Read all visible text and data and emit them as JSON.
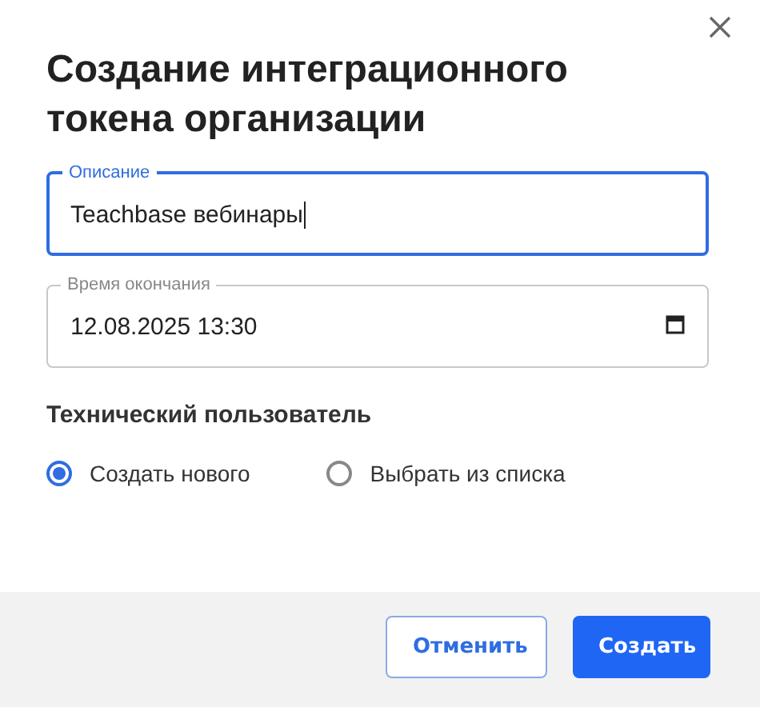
{
  "dialog": {
    "title": "Создание интеграционного токена организации"
  },
  "fields": [
    {
      "label": "Описание",
      "value": "Teachbase вебинары",
      "focused": true,
      "kind": "text"
    },
    {
      "label": "Время окончания",
      "value": "12.08.2025 13:30",
      "focused": false,
      "kind": "datetime"
    }
  ],
  "section": {
    "title": "Технический пользователь"
  },
  "radios": [
    {
      "label": "Создать нового",
      "selected": true
    },
    {
      "label": "Выбрать из списка",
      "selected": false
    }
  ],
  "buttons": [
    {
      "label": "Отменить",
      "kind": "secondary"
    },
    {
      "label": "Создать",
      "kind": "primary"
    }
  ]
}
